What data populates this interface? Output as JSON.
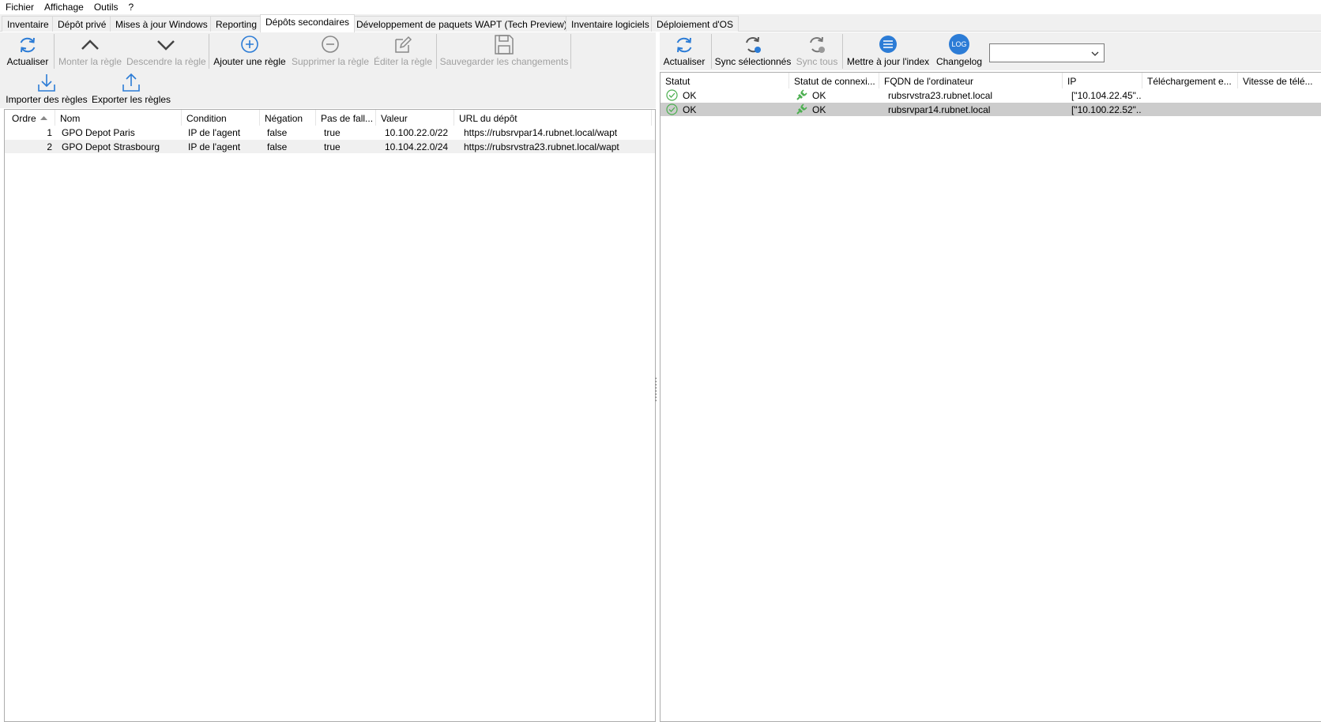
{
  "menu": [
    "Fichier",
    "Affichage",
    "Outils",
    "?"
  ],
  "tabs": [
    {
      "label": "Inventaire",
      "active": false
    },
    {
      "label": "Dépôt privé",
      "active": false
    },
    {
      "label": "Mises à jour Windows",
      "active": false
    },
    {
      "label": "Reporting",
      "active": false
    },
    {
      "label": "Dépôts secondaires",
      "active": true
    },
    {
      "label": "Développement de paquets WAPT (Tech Preview)",
      "active": false
    },
    {
      "label": "Inventaire logiciels",
      "active": false
    },
    {
      "label": "Déploiement d'OS",
      "active": false
    }
  ],
  "left_toolbar": {
    "refresh": {
      "label": "Actualiser",
      "icon": "refresh-icon",
      "enabled": true
    },
    "move_up": {
      "label": "Monter la règle",
      "icon": "chevron-up-icon",
      "enabled": false
    },
    "move_down": {
      "label": "Descendre la règle",
      "icon": "chevron-down-icon",
      "enabled": false
    },
    "add_rule": {
      "label": "Ajouter une règle",
      "icon": "plus-circle-icon",
      "enabled": true
    },
    "delete_rule": {
      "label": "Supprimer la règle",
      "icon": "minus-circle-icon",
      "enabled": false
    },
    "edit_rule": {
      "label": "Éditer la règle",
      "icon": "edit-icon",
      "enabled": false
    },
    "save_changes": {
      "label": "Sauvegarder les changements",
      "icon": "save-icon",
      "enabled": false
    },
    "import_rules": {
      "label": "Importer des règles",
      "icon": "download-icon",
      "enabled": true
    },
    "export_rules": {
      "label": "Exporter les règles",
      "icon": "upload-icon",
      "enabled": true
    }
  },
  "rules_table": {
    "headers": [
      "Ordre",
      "Nom",
      "Condition",
      "Négation",
      "Pas de fall...",
      "Valeur",
      "URL du dépôt"
    ],
    "sort_column": "Ordre",
    "sort_direction": "ascending",
    "rows": [
      [
        "1",
        "GPO Depot Paris",
        "IP de l'agent",
        "false",
        "true",
        "10.100.22.0/22",
        "https://rubsrvpar14.rubnet.local/wapt"
      ],
      [
        "2",
        "GPO Depot Strasbourg",
        "IP de l'agent",
        "false",
        "true",
        "10.104.22.0/24",
        "https://rubsrvstra23.rubnet.local/wapt"
      ]
    ]
  },
  "right_toolbar": {
    "refresh": {
      "label": "Actualiser",
      "icon": "refresh-icon",
      "enabled": true
    },
    "sync_selected": {
      "label": "Sync sélectionnés",
      "icon": "sync-icon",
      "enabled": true
    },
    "sync_all": {
      "label": "Sync tous",
      "icon": "sync-icon",
      "enabled": false
    },
    "update_index": {
      "label": "Mettre à jour l'index",
      "icon": "list-circle-icon",
      "enabled": true
    },
    "changelog": {
      "label": "Changelog",
      "icon": "log-icon",
      "icon_text": "LOG",
      "enabled": true
    },
    "combo_value": ""
  },
  "repos_table": {
    "headers": [
      "Statut",
      "Statut de connexi...",
      "FQDN de l'ordinateur",
      "IP",
      "Téléchargement e...",
      "Vitesse de télé..."
    ],
    "rows": [
      [
        "OK",
        "OK",
        "rubsrvstra23.rubnet.local",
        "[\"10.104.22.45\"...",
        "",
        ""
      ],
      [
        "OK",
        "OK",
        "rubsrvpar14.rubnet.local",
        "[\"10.100.22.52\"...",
        "",
        ""
      ]
    ],
    "selected_row": 1
  },
  "colors": {
    "accent_blue": "#2c7cd6",
    "ok_green": "#4caf50",
    "disabled_text": "#a0a0a0",
    "selection": "#cccccc"
  }
}
